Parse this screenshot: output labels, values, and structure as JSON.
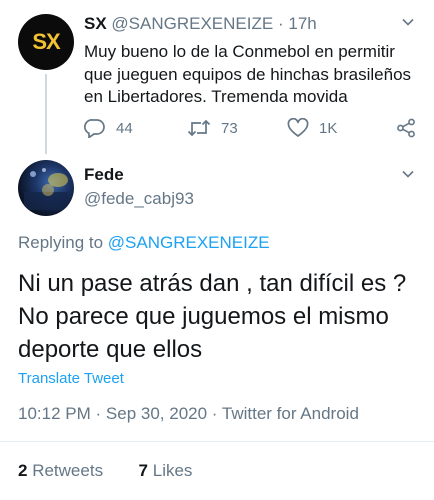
{
  "parent_tweet": {
    "avatar_text": "SX",
    "display_name": "SX",
    "handle": "@SANGREXENEIZE",
    "separator": "·",
    "time": "17h",
    "text": "Muy bueno lo de la Conmebol en permitir que jueguen equipos de hinchas brasileños en Libertadores. Tremenda movida",
    "replies": "44",
    "retweets": "73",
    "likes": "1K"
  },
  "tweet": {
    "display_name": "Fede",
    "handle": "@fede_cabj93",
    "replying_prefix": "Replying to ",
    "replying_to": "@SANGREXENEIZE",
    "text": "Ni un pase atrás dan , tan difícil es ? No parece que juguemos el mismo deporte que ellos",
    "translate_label": "Translate Tweet",
    "time": "10:12 PM",
    "dot": "·",
    "date": "Sep 30, 2020",
    "source": "Twitter for Android",
    "retweets_count": "2",
    "retweets_label": "Retweets",
    "likes_count": "7",
    "likes_label": "Likes"
  },
  "colors": {
    "accent": "#1da1f2",
    "secondary_text": "#657786",
    "primary_text": "#14171a"
  },
  "icons": [
    "chevron-down-icon",
    "reply-icon",
    "retweet-icon",
    "like-icon",
    "share-icon"
  ]
}
